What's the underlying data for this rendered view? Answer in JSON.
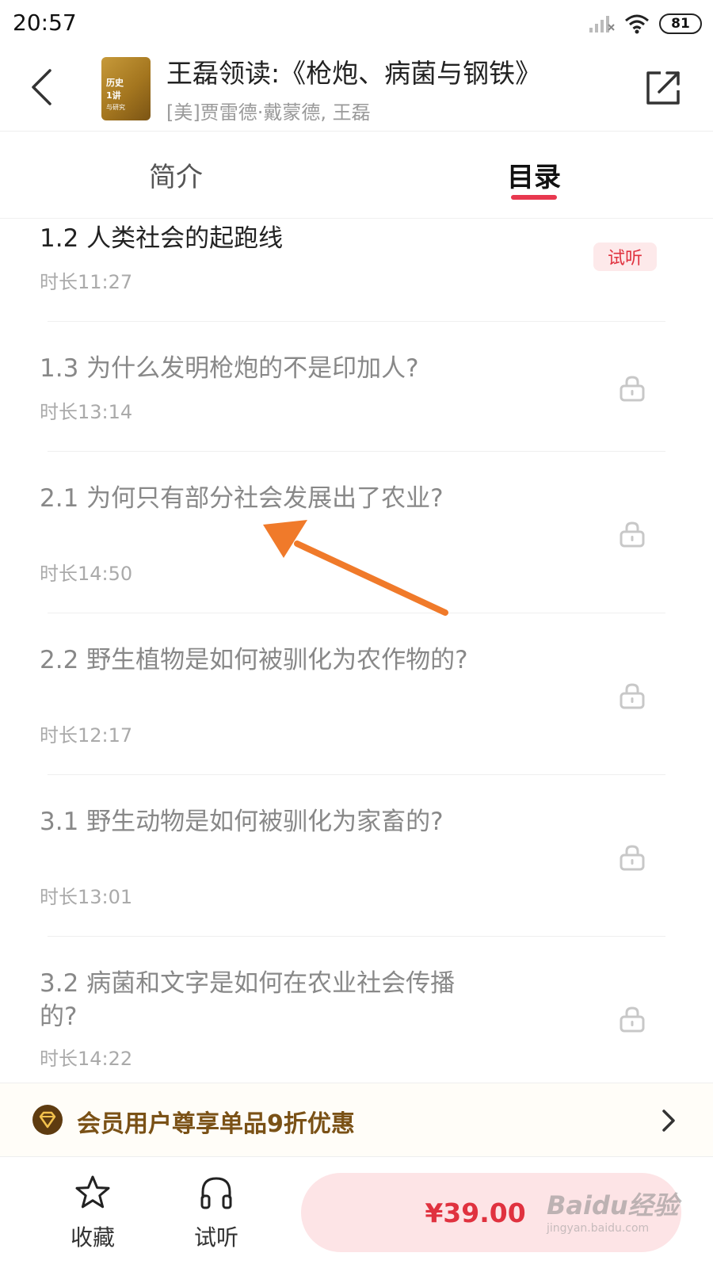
{
  "status_bar": {
    "time": "20:57",
    "battery": "81"
  },
  "header": {
    "title": "王磊领读:《枪炮、病菌与钢铁》",
    "author": "[美]贾雷德·戴蒙德, 王磊",
    "cover_text": [
      "历史",
      "1讲",
      "与研究"
    ]
  },
  "tabs": [
    {
      "label": "简介",
      "active": false
    },
    {
      "label": "目录",
      "active": true
    }
  ],
  "catalog": [
    {
      "title": "1.2 人类社会的起跑线",
      "duration": "时长11:27",
      "status": "trial",
      "badge": "试听"
    },
    {
      "title": "1.3 为什么发明枪炮的不是印加人?",
      "duration": "时长13:14",
      "status": "locked"
    },
    {
      "title": "2.1 为何只有部分社会发展出了农业?",
      "duration": "时长14:50",
      "status": "locked"
    },
    {
      "title": "2.2 野生植物是如何被驯化为农作物的?",
      "duration": "时长12:17",
      "status": "locked"
    },
    {
      "title": "3.1 野生动物是如何被驯化为家畜的?",
      "duration": "时长13:01",
      "status": "locked"
    },
    {
      "title": "3.2 病菌和文字是如何在农业社会传播的?",
      "duration": "时长14:22",
      "status": "locked"
    }
  ],
  "member_banner": {
    "text": "会员用户尊享单品9折优惠"
  },
  "bottom_bar": {
    "favorite_label": "收藏",
    "listen_label": "试听",
    "price": "¥39.00"
  },
  "watermark": {
    "text": "Baidu经验",
    "sub": "jingyan.baidu.com"
  },
  "colors": {
    "accent": "#e8384f",
    "price": "#e0323f",
    "member": "#7a5116",
    "annotation": "#f07a2a"
  }
}
